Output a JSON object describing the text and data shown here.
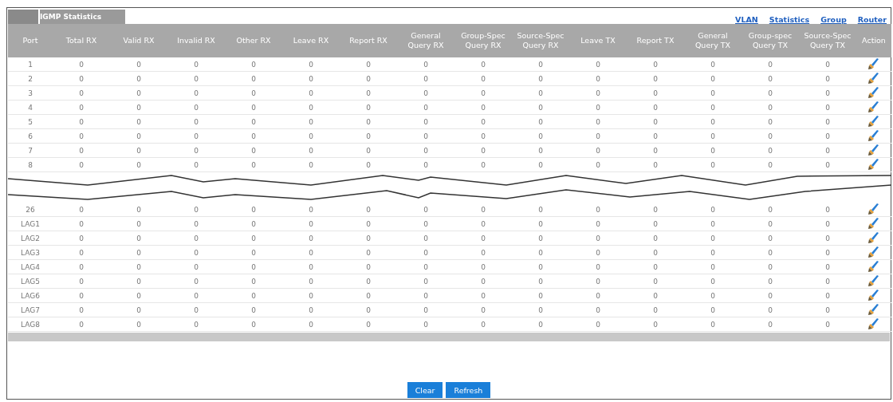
{
  "tab": {
    "label": "IGMP Statistics"
  },
  "links": [
    "VLAN",
    "Statistics",
    "Group",
    "Router"
  ],
  "table": {
    "columns": [
      "Port",
      "Total RX",
      "Valid RX",
      "Invalid RX",
      "Other RX",
      "Leave RX",
      "Report RX",
      "General Query RX",
      "Group-Spec Query RX",
      "Source-Spec Query RX",
      "Leave TX",
      "Report TX",
      "General Query TX",
      "Group-spec Query TX",
      "Source-Spec Query TX",
      "Action"
    ],
    "rows": [
      {
        "kind": "row",
        "port": "1",
        "values": [
          "0",
          "0",
          "0",
          "0",
          "0",
          "0",
          "0",
          "0",
          "0",
          "0",
          "0",
          "0",
          "0",
          "0"
        ]
      },
      {
        "kind": "row",
        "port": "2",
        "values": [
          "0",
          "0",
          "0",
          "0",
          "0",
          "0",
          "0",
          "0",
          "0",
          "0",
          "0",
          "0",
          "0",
          "0"
        ]
      },
      {
        "kind": "row",
        "port": "3",
        "values": [
          "0",
          "0",
          "0",
          "0",
          "0",
          "0",
          "0",
          "0",
          "0",
          "0",
          "0",
          "0",
          "0",
          "0"
        ]
      },
      {
        "kind": "row",
        "port": "4",
        "values": [
          "0",
          "0",
          "0",
          "0",
          "0",
          "0",
          "0",
          "0",
          "0",
          "0",
          "0",
          "0",
          "0",
          "0"
        ]
      },
      {
        "kind": "row",
        "port": "5",
        "values": [
          "0",
          "0",
          "0",
          "0",
          "0",
          "0",
          "0",
          "0",
          "0",
          "0",
          "0",
          "0",
          "0",
          "0"
        ]
      },
      {
        "kind": "row",
        "port": "6",
        "values": [
          "0",
          "0",
          "0",
          "0",
          "0",
          "0",
          "0",
          "0",
          "0",
          "0",
          "0",
          "0",
          "0",
          "0"
        ]
      },
      {
        "kind": "row",
        "port": "7",
        "values": [
          "0",
          "0",
          "0",
          "0",
          "0",
          "0",
          "0",
          "0",
          "0",
          "0",
          "0",
          "0",
          "0",
          "0"
        ]
      },
      {
        "kind": "row",
        "port": "8",
        "values": [
          "0",
          "0",
          "0",
          "0",
          "0",
          "0",
          "0",
          "0",
          "0",
          "0",
          "0",
          "0",
          "0",
          "0"
        ]
      },
      {
        "kind": "break"
      },
      {
        "kind": "row",
        "port": "26",
        "values": [
          "0",
          "0",
          "0",
          "0",
          "0",
          "0",
          "0",
          "0",
          "0",
          "0",
          "0",
          "0",
          "0",
          "0"
        ]
      },
      {
        "kind": "row",
        "port": "LAG1",
        "values": [
          "0",
          "0",
          "0",
          "0",
          "0",
          "0",
          "0",
          "0",
          "0",
          "0",
          "0",
          "0",
          "0",
          "0"
        ]
      },
      {
        "kind": "row",
        "port": "LAG2",
        "values": [
          "0",
          "0",
          "0",
          "0",
          "0",
          "0",
          "0",
          "0",
          "0",
          "0",
          "0",
          "0",
          "0",
          "0"
        ]
      },
      {
        "kind": "row",
        "port": "LAG3",
        "values": [
          "0",
          "0",
          "0",
          "0",
          "0",
          "0",
          "0",
          "0",
          "0",
          "0",
          "0",
          "0",
          "0",
          "0"
        ]
      },
      {
        "kind": "row",
        "port": "LAG4",
        "values": [
          "0",
          "0",
          "0",
          "0",
          "0",
          "0",
          "0",
          "0",
          "0",
          "0",
          "0",
          "0",
          "0",
          "0"
        ]
      },
      {
        "kind": "row",
        "port": "LAG5",
        "values": [
          "0",
          "0",
          "0",
          "0",
          "0",
          "0",
          "0",
          "0",
          "0",
          "0",
          "0",
          "0",
          "0",
          "0"
        ]
      },
      {
        "kind": "row",
        "port": "LAG6",
        "values": [
          "0",
          "0",
          "0",
          "0",
          "0",
          "0",
          "0",
          "0",
          "0",
          "0",
          "0",
          "0",
          "0",
          "0"
        ]
      },
      {
        "kind": "row",
        "port": "LAG7",
        "values": [
          "0",
          "0",
          "0",
          "0",
          "0",
          "0",
          "0",
          "0",
          "0",
          "0",
          "0",
          "0",
          "0",
          "0"
        ]
      },
      {
        "kind": "row",
        "port": "LAG8",
        "values": [
          "0",
          "0",
          "0",
          "0",
          "0",
          "0",
          "0",
          "0",
          "0",
          "0",
          "0",
          "0",
          "0",
          "0"
        ]
      }
    ]
  },
  "buttons": [
    "Clear",
    "Refresh"
  ]
}
